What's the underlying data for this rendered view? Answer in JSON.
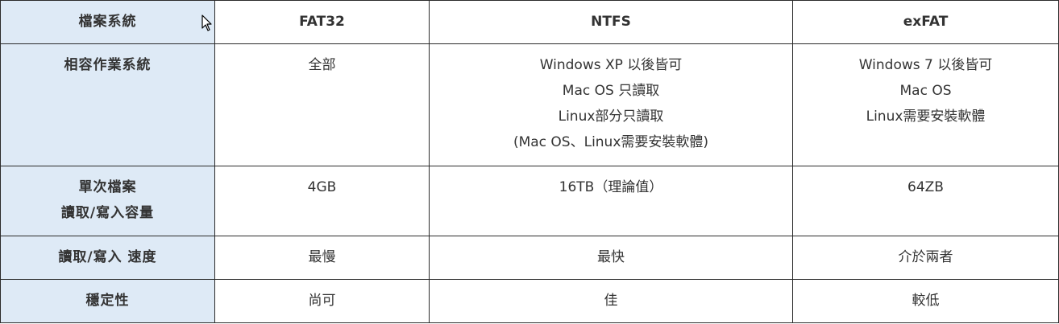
{
  "table": {
    "corner": "檔案系統",
    "columns": [
      "FAT32",
      "NTFS",
      "exFAT"
    ],
    "rows": [
      {
        "label": [
          "相容作業系統"
        ],
        "cells": [
          [
            "全部"
          ],
          [
            "Windows XP 以後皆可",
            "Mac OS 只讀取",
            "Linux部分只讀取",
            "(Mac OS、Linux需要安裝軟體)"
          ],
          [
            "Windows 7 以後皆可",
            "Mac OS",
            "Linux需要安裝軟體"
          ]
        ]
      },
      {
        "label": [
          "單次檔案",
          "讀取/寫入容量"
        ],
        "cells": [
          [
            "4GB"
          ],
          [
            "16TB（理論值）"
          ],
          [
            "64ZB"
          ]
        ]
      },
      {
        "label": [
          "讀取/寫入 速度"
        ],
        "cells": [
          [
            "最慢"
          ],
          [
            "最快"
          ],
          [
            "介於兩者"
          ]
        ]
      },
      {
        "label": [
          "穩定性"
        ],
        "cells": [
          [
            "尚可"
          ],
          [
            "佳"
          ],
          [
            "較低"
          ]
        ]
      }
    ]
  },
  "colors": {
    "header_bg": "#deeaf6",
    "border": "#2b2b2b",
    "text": "#333333"
  },
  "icons": {
    "cursor": "mouse-pointer-icon"
  }
}
